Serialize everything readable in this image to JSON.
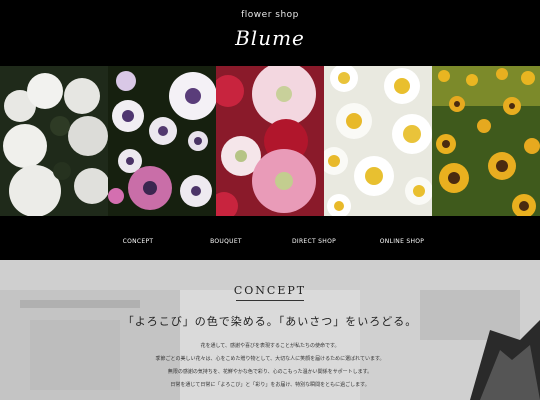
{
  "header": {
    "tagline": "flower shop",
    "brand": "Blume"
  },
  "gallery": {
    "panels": [
      {
        "subject": "white hydrangea"
      },
      {
        "subject": "white and purple african daisies"
      },
      {
        "subject": "pink and white gerberas"
      },
      {
        "subject": "white and yellow daisies"
      },
      {
        "subject": "sunflower field"
      }
    ]
  },
  "nav": {
    "items": [
      "CONCEPT",
      "BOUQUET",
      "DIRECT SHOP",
      "ONLINE SHOP"
    ]
  },
  "concept": {
    "title": "CONCEPT",
    "heading": "「よろこび」の色で染める。「あいさつ」をいろどる。",
    "body": [
      "花を通して、感謝や喜びを表現することが私たちの使命です。",
      "季節ごとの美しい花々は、心をこめた贈り物として、大切な人に笑顔を届けるために選ばれています。",
      "無限の感謝の気持ちを、花鮮やかな色で彩り、心のこもった温かい関係をサポートします。",
      "日常を通じて日常に「よろこび」と「彩り」をお届け、特別な瞬間をともに過ごします。"
    ]
  },
  "colors": {
    "background": "#000000",
    "text_light": "#ffffff",
    "concept_bg": "#d9d9d9"
  }
}
